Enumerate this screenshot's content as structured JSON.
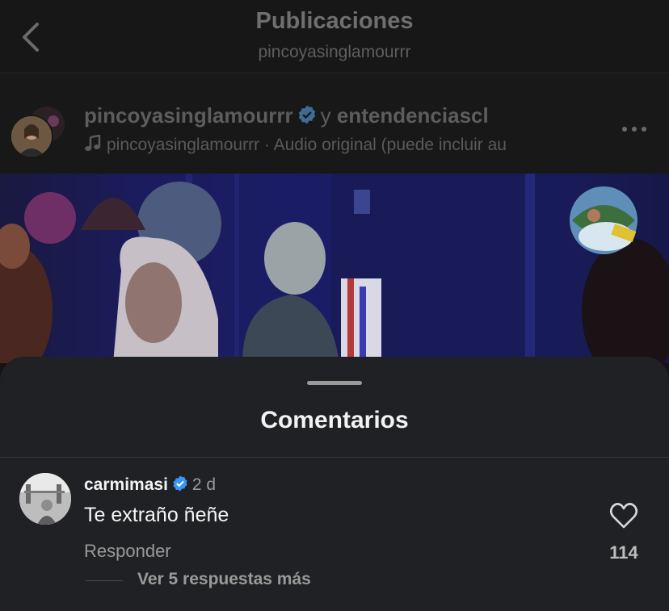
{
  "header": {
    "title": "Publicaciones",
    "subtitle": "pincoyasinglamourrr"
  },
  "post": {
    "author1": "pincoyasinglamourrr",
    "conjunction": "y",
    "author2": "entendenciascl",
    "audio_line": "pincoyasinglamourrr · Audio original  (puede incluir au"
  },
  "comments_sheet": {
    "title": "Comentarios",
    "comment": {
      "username": "carmimasi",
      "time": "2 d",
      "text": "Te extraño ñeñe",
      "reply_label": "Responder",
      "like_count": "114",
      "view_replies": "Ver 5 respuestas más"
    }
  },
  "colors": {
    "accent_verified": "#3897f0",
    "background": "#141414",
    "sheet": "#1f2124"
  },
  "icons": [
    "back-chevron-icon",
    "verified-icon",
    "music-note-icon",
    "more-options-icon",
    "heart-icon"
  ]
}
